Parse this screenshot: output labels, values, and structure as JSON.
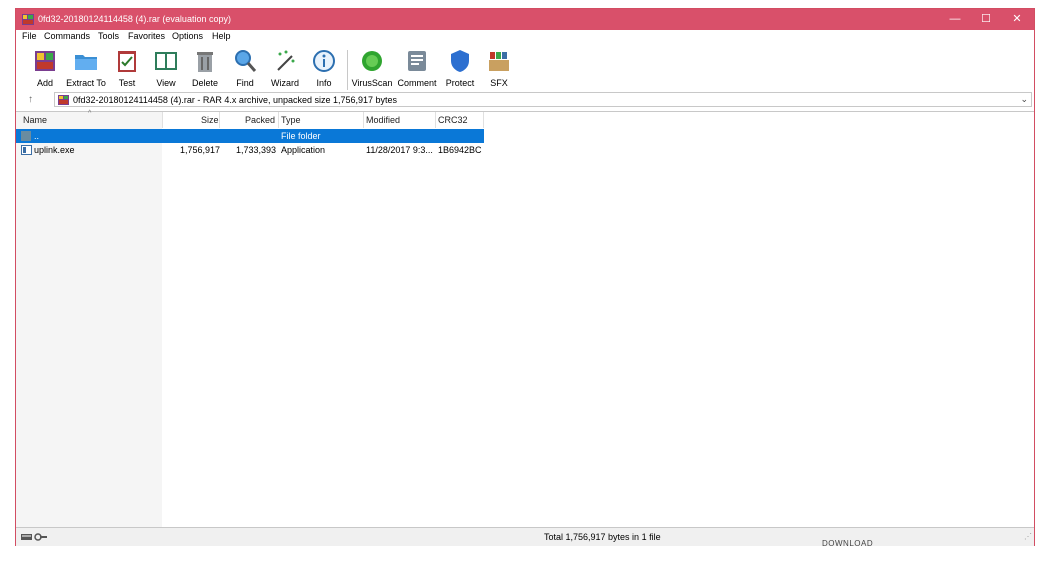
{
  "window": {
    "title": "0fd32-20180124114458 (4).rar (evaluation copy)",
    "controls": {
      "minimize": "—",
      "maximize": "☐",
      "close": "✕"
    },
    "accent_color": "#d9506a"
  },
  "menu": [
    "File",
    "Commands",
    "Tools",
    "Favorites",
    "Options",
    "Help"
  ],
  "toolbar": [
    {
      "label": "Add",
      "icon": "add-archive-icon"
    },
    {
      "label": "Extract To",
      "icon": "extract-folder-icon"
    },
    {
      "label": "Test",
      "icon": "test-clipboard-icon"
    },
    {
      "label": "View",
      "icon": "view-book-icon"
    },
    {
      "label": "Delete",
      "icon": "delete-trash-icon"
    },
    {
      "label": "Find",
      "icon": "find-magnifier-icon"
    },
    {
      "label": "Wizard",
      "icon": "wizard-wand-icon"
    },
    {
      "label": "Info",
      "icon": "info-icon"
    },
    {
      "label": "VirusScan",
      "icon": "virus-scan-icon"
    },
    {
      "label": "Comment",
      "icon": "comment-icon"
    },
    {
      "label": "Protect",
      "icon": "protect-shield-icon"
    },
    {
      "label": "SFX",
      "icon": "sfx-box-icon"
    }
  ],
  "address": {
    "text": "0fd32-20180124114458 (4).rar - RAR 4.x archive, unpacked size 1,756,917 bytes"
  },
  "columns": [
    "Name",
    "Size",
    "Packed",
    "Type",
    "Modified",
    "CRC32"
  ],
  "files": [
    {
      "name": "..",
      "size": "",
      "packed": "",
      "type": "File folder",
      "modified": "",
      "crc": "",
      "selected": true
    },
    {
      "name": "uplink.exe",
      "size": "1,756,917",
      "packed": "1,733,393",
      "type": "Application",
      "modified": "11/28/2017 9:3...",
      "crc": "1B6942BC",
      "selected": false
    }
  ],
  "status": {
    "text": "Total 1,756,917 bytes in 1 file"
  },
  "background_text": "DOWNLOAD"
}
